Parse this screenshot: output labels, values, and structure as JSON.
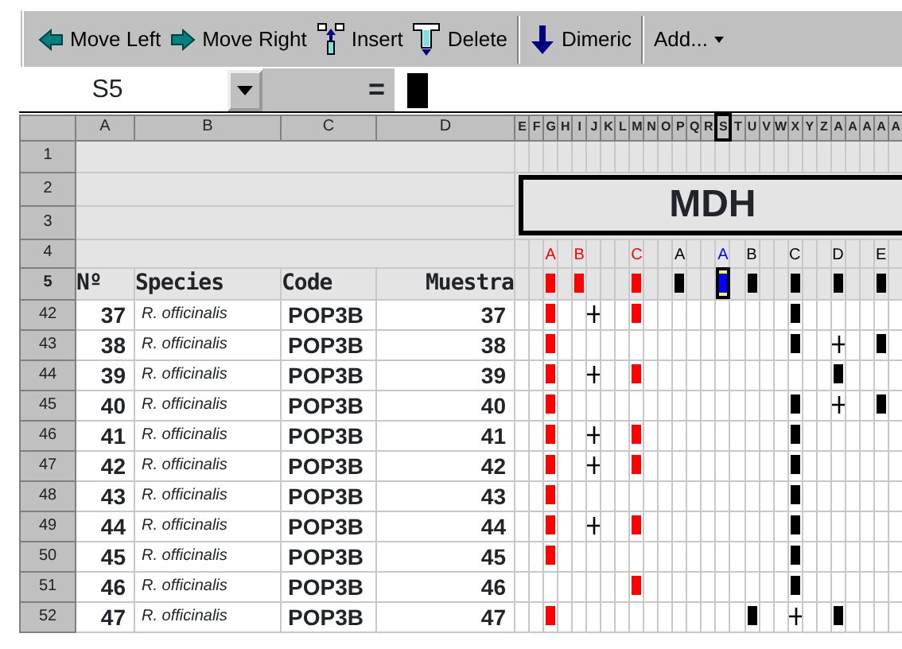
{
  "toolbar": [
    {
      "label": "Move Left",
      "kind": "left"
    },
    {
      "label": "Move Right",
      "kind": "right"
    },
    {
      "label": "Insert",
      "kind": "insert"
    },
    {
      "label": "Delete",
      "kind": "delete"
    },
    {
      "label": "Dimeric",
      "kind": "dimeric"
    },
    {
      "label": "Add...",
      "kind": "menu"
    }
  ],
  "formula_bar": {
    "cell_ref": "S5",
    "equals": "="
  },
  "columns": [
    "A",
    "B",
    "C",
    "D"
  ],
  "row_numbers": [
    "1",
    "2",
    "3",
    "4",
    "5"
  ],
  "title": "MDH",
  "headers": [
    "Nº",
    "Species",
    "Code",
    "Muestra"
  ],
  "marker_columns": [
    {
      "letter": "E",
      "selected": false,
      "kind": "blank"
    },
    {
      "letter": "F",
      "selected": false,
      "kind": "blank"
    },
    {
      "letter": "G",
      "selected": false,
      "kind": "red",
      "allele": "A",
      "color": "#ff0000"
    },
    {
      "letter": "H",
      "selected": false,
      "kind": "blank"
    },
    {
      "letter": "I",
      "selected": false,
      "kind": "red",
      "allele": "B",
      "color": "#ff0000"
    },
    {
      "letter": "J",
      "selected": false,
      "kind": "blank"
    },
    {
      "letter": "K",
      "selected": false,
      "kind": "blank"
    },
    {
      "letter": "L",
      "selected": false,
      "kind": "blank"
    },
    {
      "letter": "M",
      "selected": false,
      "kind": "red",
      "allele": "C",
      "color": "#ff0000"
    },
    {
      "letter": "N",
      "selected": false,
      "kind": "blank"
    },
    {
      "letter": "O",
      "selected": false,
      "kind": "blank"
    },
    {
      "letter": "P",
      "selected": false,
      "kind": "black",
      "allele": "A",
      "color": "#000000"
    },
    {
      "letter": "Q",
      "selected": false,
      "kind": "blank"
    },
    {
      "letter": "R",
      "selected": false,
      "kind": "blank"
    },
    {
      "letter": "S",
      "selected": true,
      "kind": "blue",
      "allele": "A",
      "color": "#0000ff"
    },
    {
      "letter": "T",
      "selected": false,
      "kind": "blank"
    },
    {
      "letter": "U",
      "selected": false,
      "kind": "black",
      "allele": "B",
      "color": "#000000"
    },
    {
      "letter": "V",
      "selected": false,
      "kind": "blank"
    },
    {
      "letter": "W",
      "selected": false,
      "kind": "blank"
    },
    {
      "letter": "X",
      "selected": false,
      "kind": "black",
      "allele": "C",
      "color": "#000000"
    },
    {
      "letter": "Y",
      "selected": false,
      "kind": "blank"
    },
    {
      "letter": "Z",
      "selected": false,
      "kind": "blank"
    },
    {
      "letter": "A",
      "selected": false,
      "kind": "black",
      "allele": "D",
      "color": "#000000"
    },
    {
      "letter": "A",
      "selected": false,
      "kind": "blank"
    },
    {
      "letter": "A",
      "selected": false,
      "kind": "blank"
    },
    {
      "letter": "A",
      "selected": false,
      "kind": "black",
      "allele": "E",
      "color": "#000000"
    },
    {
      "letter": "A",
      "selected": false,
      "kind": "blank"
    }
  ],
  "rows": [
    {
      "row": "42",
      "n": "37",
      "species": "R. officinalis",
      "code": "POP3B",
      "muestra": "37",
      "cells": [
        {
          "kind": "blank"
        },
        {
          "kind": "blank"
        },
        {
          "kind": "red"
        },
        {
          "kind": "blank"
        },
        {
          "kind": "blank"
        },
        {
          "kind": "plus"
        },
        {
          "kind": "blank"
        },
        {
          "kind": "blank"
        },
        {
          "kind": "red"
        },
        {
          "kind": "blank"
        },
        {
          "kind": "blank"
        },
        {
          "kind": "blank"
        },
        {
          "kind": "blank"
        },
        {
          "kind": "blank"
        },
        {
          "kind": "blank"
        },
        {
          "kind": "blank"
        },
        {
          "kind": "blank"
        },
        {
          "kind": "blank"
        },
        {
          "kind": "blank"
        },
        {
          "kind": "black"
        },
        {
          "kind": "blank"
        },
        {
          "kind": "blank"
        },
        {
          "kind": "blank"
        },
        {
          "kind": "blank"
        },
        {
          "kind": "blank"
        },
        {
          "kind": "blank"
        },
        {
          "kind": "blank"
        }
      ]
    },
    {
      "row": "43",
      "n": "38",
      "species": "R. officinalis",
      "code": "POP3B",
      "muestra": "38",
      "cells": [
        {
          "kind": "blank"
        },
        {
          "kind": "blank"
        },
        {
          "kind": "red"
        },
        {
          "kind": "blank"
        },
        {
          "kind": "blank"
        },
        {
          "kind": "blank"
        },
        {
          "kind": "blank"
        },
        {
          "kind": "blank"
        },
        {
          "kind": "blank"
        },
        {
          "kind": "blank"
        },
        {
          "kind": "blank"
        },
        {
          "kind": "blank"
        },
        {
          "kind": "blank"
        },
        {
          "kind": "blank"
        },
        {
          "kind": "blank"
        },
        {
          "kind": "blank"
        },
        {
          "kind": "blank"
        },
        {
          "kind": "blank"
        },
        {
          "kind": "blank"
        },
        {
          "kind": "black"
        },
        {
          "kind": "blank"
        },
        {
          "kind": "blank"
        },
        {
          "kind": "plus"
        },
        {
          "kind": "blank"
        },
        {
          "kind": "blank"
        },
        {
          "kind": "black"
        },
        {
          "kind": "blank"
        }
      ]
    },
    {
      "row": "44",
      "n": "39",
      "species": "R. officinalis",
      "code": "POP3B",
      "muestra": "39",
      "cells": [
        {
          "kind": "blank"
        },
        {
          "kind": "blank"
        },
        {
          "kind": "red"
        },
        {
          "kind": "blank"
        },
        {
          "kind": "blank"
        },
        {
          "kind": "plus"
        },
        {
          "kind": "blank"
        },
        {
          "kind": "blank"
        },
        {
          "kind": "red"
        },
        {
          "kind": "blank"
        },
        {
          "kind": "blank"
        },
        {
          "kind": "blank"
        },
        {
          "kind": "blank"
        },
        {
          "kind": "blank"
        },
        {
          "kind": "blank"
        },
        {
          "kind": "blank"
        },
        {
          "kind": "blank"
        },
        {
          "kind": "blank"
        },
        {
          "kind": "blank"
        },
        {
          "kind": "blank"
        },
        {
          "kind": "blank"
        },
        {
          "kind": "blank"
        },
        {
          "kind": "black"
        },
        {
          "kind": "blank"
        },
        {
          "kind": "blank"
        },
        {
          "kind": "blank"
        },
        {
          "kind": "blank"
        }
      ]
    },
    {
      "row": "45",
      "n": "40",
      "species": "R. officinalis",
      "code": "POP3B",
      "muestra": "40",
      "cells": [
        {
          "kind": "blank"
        },
        {
          "kind": "blank"
        },
        {
          "kind": "red"
        },
        {
          "kind": "blank"
        },
        {
          "kind": "blank"
        },
        {
          "kind": "blank"
        },
        {
          "kind": "blank"
        },
        {
          "kind": "blank"
        },
        {
          "kind": "blank"
        },
        {
          "kind": "blank"
        },
        {
          "kind": "blank"
        },
        {
          "kind": "blank"
        },
        {
          "kind": "blank"
        },
        {
          "kind": "blank"
        },
        {
          "kind": "blank"
        },
        {
          "kind": "blank"
        },
        {
          "kind": "blank"
        },
        {
          "kind": "blank"
        },
        {
          "kind": "blank"
        },
        {
          "kind": "black"
        },
        {
          "kind": "blank"
        },
        {
          "kind": "blank"
        },
        {
          "kind": "plus"
        },
        {
          "kind": "blank"
        },
        {
          "kind": "blank"
        },
        {
          "kind": "black"
        },
        {
          "kind": "blank"
        }
      ]
    },
    {
      "row": "46",
      "n": "41",
      "species": "R. officinalis",
      "code": "POP3B",
      "muestra": "41",
      "cells": [
        {
          "kind": "blank"
        },
        {
          "kind": "blank"
        },
        {
          "kind": "red"
        },
        {
          "kind": "blank"
        },
        {
          "kind": "blank"
        },
        {
          "kind": "plus"
        },
        {
          "kind": "blank"
        },
        {
          "kind": "blank"
        },
        {
          "kind": "red"
        },
        {
          "kind": "blank"
        },
        {
          "kind": "blank"
        },
        {
          "kind": "blank"
        },
        {
          "kind": "blank"
        },
        {
          "kind": "blank"
        },
        {
          "kind": "blank"
        },
        {
          "kind": "blank"
        },
        {
          "kind": "blank"
        },
        {
          "kind": "blank"
        },
        {
          "kind": "blank"
        },
        {
          "kind": "black"
        },
        {
          "kind": "blank"
        },
        {
          "kind": "blank"
        },
        {
          "kind": "blank"
        },
        {
          "kind": "blank"
        },
        {
          "kind": "blank"
        },
        {
          "kind": "blank"
        },
        {
          "kind": "blank"
        }
      ]
    },
    {
      "row": "47",
      "n": "42",
      "species": "R. officinalis",
      "code": "POP3B",
      "muestra": "42",
      "cells": [
        {
          "kind": "blank"
        },
        {
          "kind": "blank"
        },
        {
          "kind": "red"
        },
        {
          "kind": "blank"
        },
        {
          "kind": "blank"
        },
        {
          "kind": "plus"
        },
        {
          "kind": "blank"
        },
        {
          "kind": "blank"
        },
        {
          "kind": "red"
        },
        {
          "kind": "blank"
        },
        {
          "kind": "blank"
        },
        {
          "kind": "blank"
        },
        {
          "kind": "blank"
        },
        {
          "kind": "blank"
        },
        {
          "kind": "blank"
        },
        {
          "kind": "blank"
        },
        {
          "kind": "blank"
        },
        {
          "kind": "blank"
        },
        {
          "kind": "blank"
        },
        {
          "kind": "black"
        },
        {
          "kind": "blank"
        },
        {
          "kind": "blank"
        },
        {
          "kind": "blank"
        },
        {
          "kind": "blank"
        },
        {
          "kind": "blank"
        },
        {
          "kind": "blank"
        },
        {
          "kind": "blank"
        }
      ]
    },
    {
      "row": "48",
      "n": "43",
      "species": "R. officinalis",
      "code": "POP3B",
      "muestra": "43",
      "cells": [
        {
          "kind": "blank"
        },
        {
          "kind": "blank"
        },
        {
          "kind": "red"
        },
        {
          "kind": "blank"
        },
        {
          "kind": "blank"
        },
        {
          "kind": "blank"
        },
        {
          "kind": "blank"
        },
        {
          "kind": "blank"
        },
        {
          "kind": "blank"
        },
        {
          "kind": "blank"
        },
        {
          "kind": "blank"
        },
        {
          "kind": "blank"
        },
        {
          "kind": "blank"
        },
        {
          "kind": "blank"
        },
        {
          "kind": "blank"
        },
        {
          "kind": "blank"
        },
        {
          "kind": "blank"
        },
        {
          "kind": "blank"
        },
        {
          "kind": "blank"
        },
        {
          "kind": "black"
        },
        {
          "kind": "blank"
        },
        {
          "kind": "blank"
        },
        {
          "kind": "blank"
        },
        {
          "kind": "blank"
        },
        {
          "kind": "blank"
        },
        {
          "kind": "blank"
        },
        {
          "kind": "blank"
        }
      ]
    },
    {
      "row": "49",
      "n": "44",
      "species": "R. officinalis",
      "code": "POP3B",
      "muestra": "44",
      "cells": [
        {
          "kind": "blank"
        },
        {
          "kind": "blank"
        },
        {
          "kind": "red"
        },
        {
          "kind": "blank"
        },
        {
          "kind": "blank"
        },
        {
          "kind": "plus"
        },
        {
          "kind": "blank"
        },
        {
          "kind": "blank"
        },
        {
          "kind": "red"
        },
        {
          "kind": "blank"
        },
        {
          "kind": "blank"
        },
        {
          "kind": "blank"
        },
        {
          "kind": "blank"
        },
        {
          "kind": "blank"
        },
        {
          "kind": "blank"
        },
        {
          "kind": "blank"
        },
        {
          "kind": "blank"
        },
        {
          "kind": "blank"
        },
        {
          "kind": "blank"
        },
        {
          "kind": "black"
        },
        {
          "kind": "blank"
        },
        {
          "kind": "blank"
        },
        {
          "kind": "blank"
        },
        {
          "kind": "blank"
        },
        {
          "kind": "blank"
        },
        {
          "kind": "blank"
        },
        {
          "kind": "blank"
        }
      ]
    },
    {
      "row": "50",
      "n": "45",
      "species": "R. officinalis",
      "code": "POP3B",
      "muestra": "45",
      "cells": [
        {
          "kind": "blank"
        },
        {
          "kind": "blank"
        },
        {
          "kind": "red"
        },
        {
          "kind": "blank"
        },
        {
          "kind": "blank"
        },
        {
          "kind": "blank"
        },
        {
          "kind": "blank"
        },
        {
          "kind": "blank"
        },
        {
          "kind": "blank"
        },
        {
          "kind": "blank"
        },
        {
          "kind": "blank"
        },
        {
          "kind": "blank"
        },
        {
          "kind": "blank"
        },
        {
          "kind": "blank"
        },
        {
          "kind": "blank"
        },
        {
          "kind": "blank"
        },
        {
          "kind": "blank"
        },
        {
          "kind": "blank"
        },
        {
          "kind": "blank"
        },
        {
          "kind": "black"
        },
        {
          "kind": "blank"
        },
        {
          "kind": "blank"
        },
        {
          "kind": "blank"
        },
        {
          "kind": "blank"
        },
        {
          "kind": "blank"
        },
        {
          "kind": "blank"
        },
        {
          "kind": "blank"
        }
      ]
    },
    {
      "row": "51",
      "n": "46",
      "species": "R. officinalis",
      "code": "POP3B",
      "muestra": "46",
      "cells": [
        {
          "kind": "blank"
        },
        {
          "kind": "blank"
        },
        {
          "kind": "blank"
        },
        {
          "kind": "blank"
        },
        {
          "kind": "blank"
        },
        {
          "kind": "blank"
        },
        {
          "kind": "blank"
        },
        {
          "kind": "blank"
        },
        {
          "kind": "red"
        },
        {
          "kind": "blank"
        },
        {
          "kind": "blank"
        },
        {
          "kind": "blank"
        },
        {
          "kind": "blank"
        },
        {
          "kind": "blank"
        },
        {
          "kind": "blank"
        },
        {
          "kind": "blank"
        },
        {
          "kind": "blank"
        },
        {
          "kind": "blank"
        },
        {
          "kind": "blank"
        },
        {
          "kind": "black"
        },
        {
          "kind": "blank"
        },
        {
          "kind": "blank"
        },
        {
          "kind": "blank"
        },
        {
          "kind": "blank"
        },
        {
          "kind": "blank"
        },
        {
          "kind": "blank"
        },
        {
          "kind": "blank"
        }
      ]
    },
    {
      "row": "52",
      "n": "47",
      "species": "R. officinalis",
      "code": "POP3B",
      "muestra": "47",
      "cells": [
        {
          "kind": "blank"
        },
        {
          "kind": "blank"
        },
        {
          "kind": "red"
        },
        {
          "kind": "blank"
        },
        {
          "kind": "blank"
        },
        {
          "kind": "blank"
        },
        {
          "kind": "blank"
        },
        {
          "kind": "blank"
        },
        {
          "kind": "blank"
        },
        {
          "kind": "blank"
        },
        {
          "kind": "blank"
        },
        {
          "kind": "blank"
        },
        {
          "kind": "blank"
        },
        {
          "kind": "blank"
        },
        {
          "kind": "blank"
        },
        {
          "kind": "blank"
        },
        {
          "kind": "black"
        },
        {
          "kind": "blank"
        },
        {
          "kind": "blank"
        },
        {
          "kind": "plus"
        },
        {
          "kind": "blank"
        },
        {
          "kind": "blank"
        },
        {
          "kind": "black"
        },
        {
          "kind": "blank"
        },
        {
          "kind": "blank"
        },
        {
          "kind": "blank"
        },
        {
          "kind": "blank"
        }
      ]
    }
  ]
}
